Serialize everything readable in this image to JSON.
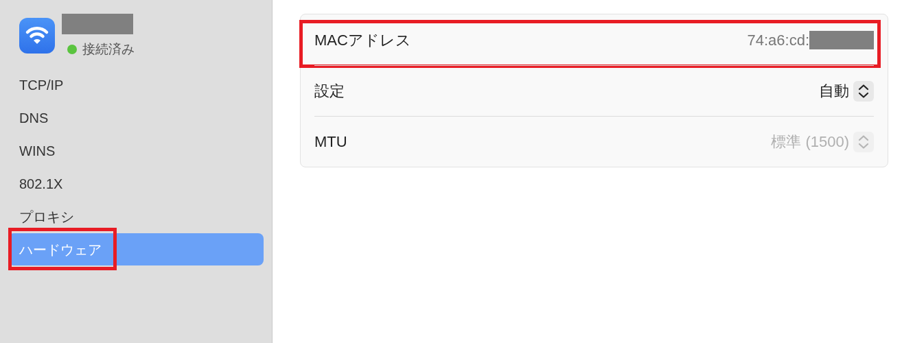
{
  "sidebar": {
    "network": {
      "name_redacted": true,
      "status": "接続済み",
      "connected": true
    },
    "items": [
      {
        "label": "TCP/IP",
        "selected": false,
        "highlighted": false
      },
      {
        "label": "DNS",
        "selected": false,
        "highlighted": false
      },
      {
        "label": "WINS",
        "selected": false,
        "highlighted": false
      },
      {
        "label": "802.1X",
        "selected": false,
        "highlighted": false
      },
      {
        "label": "プロキシ",
        "selected": false,
        "highlighted": false
      },
      {
        "label": "ハードウェア",
        "selected": true,
        "highlighted": true
      }
    ]
  },
  "settings": [
    {
      "kind": "text",
      "label": "MACアドレス",
      "value": "74:a6:cd:",
      "value_redacted": true,
      "highlighted": true
    },
    {
      "kind": "popup",
      "label": "設定",
      "value": "自動",
      "disabled": false,
      "highlighted": false
    },
    {
      "kind": "popup",
      "label": "MTU",
      "value": "標準 (1500)",
      "disabled": true,
      "highlighted": false
    }
  ]
}
